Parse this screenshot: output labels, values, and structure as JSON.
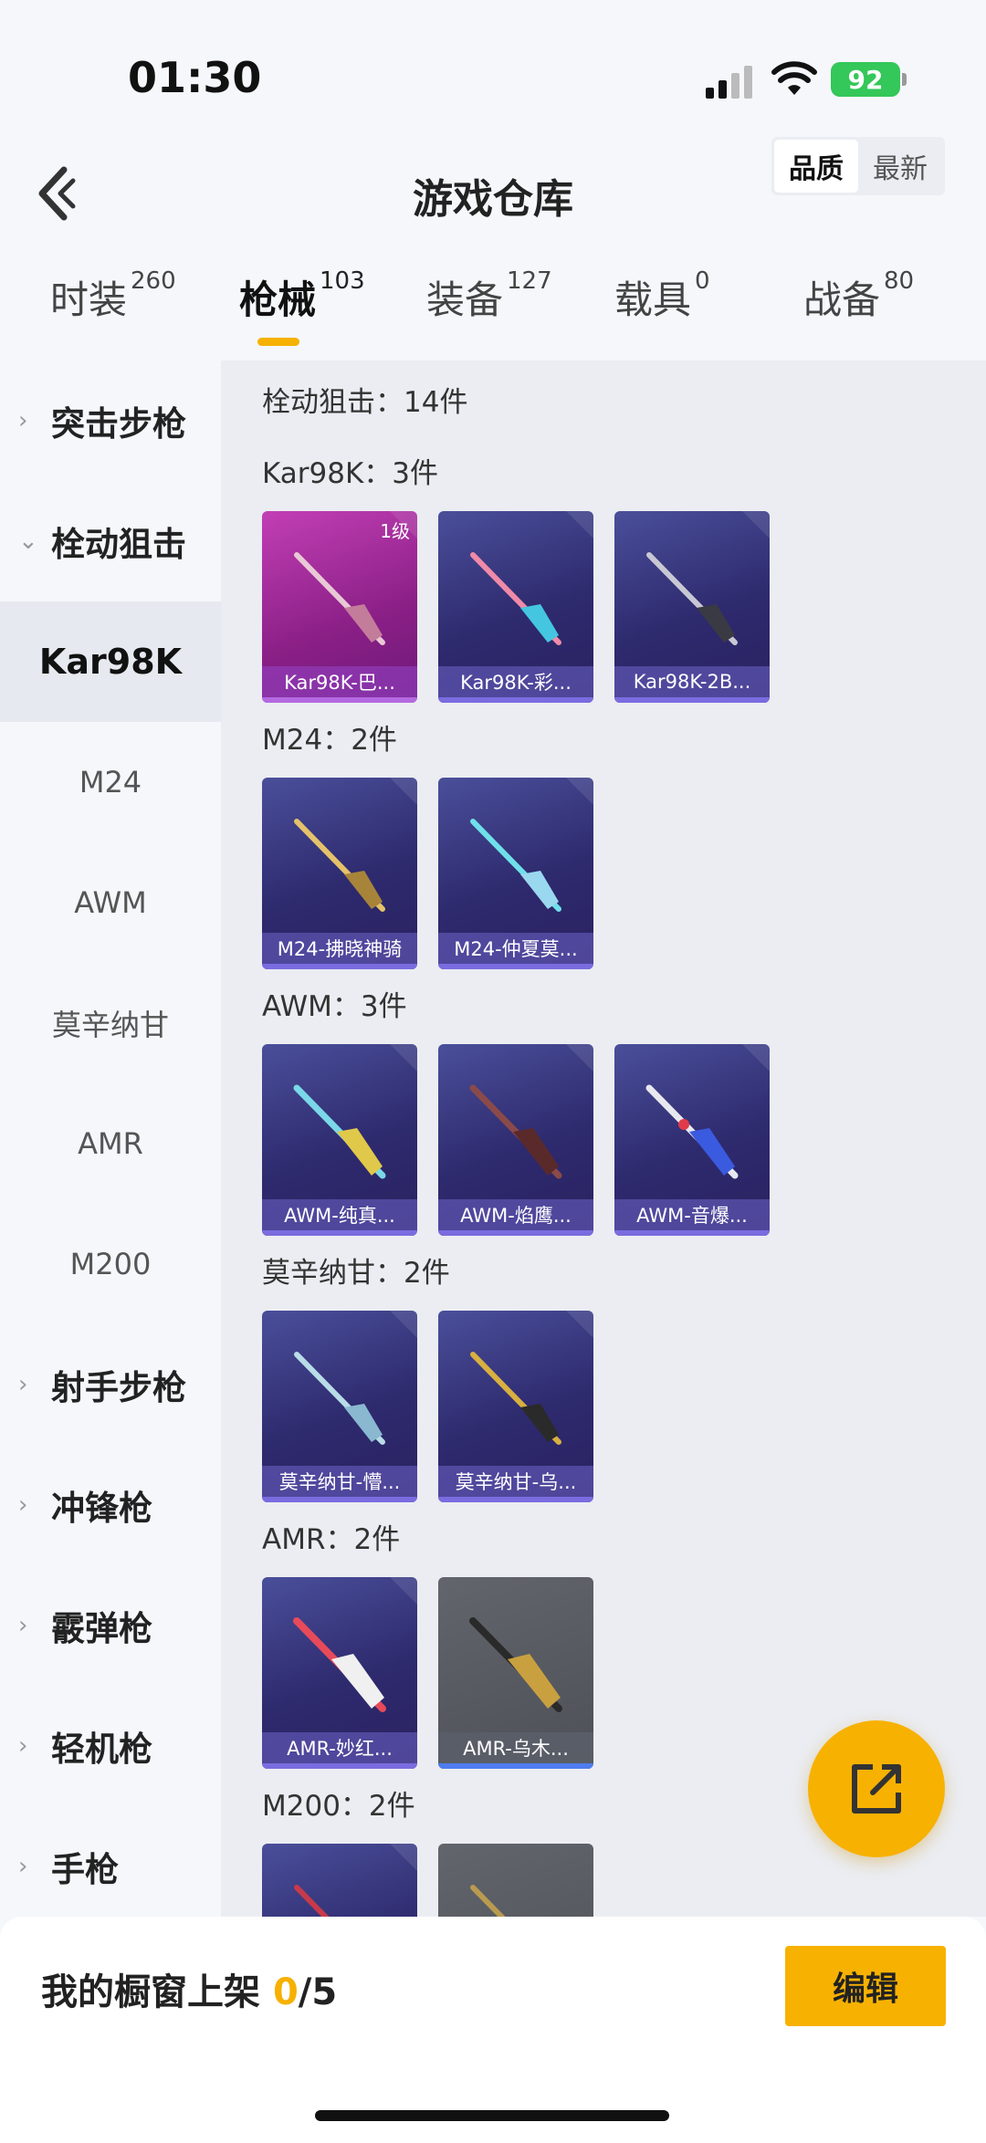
{
  "status": {
    "time": "01:30",
    "battery": "92"
  },
  "header": {
    "title": "游戏仓库",
    "sort_quality": "品质",
    "sort_newest": "最新"
  },
  "tabs": [
    {
      "label": "时装",
      "count": "260"
    },
    {
      "label": "枪械",
      "count": "103"
    },
    {
      "label": "装备",
      "count": "127"
    },
    {
      "label": "载具",
      "count": "0"
    },
    {
      "label": "战备",
      "count": "80"
    }
  ],
  "sidebar": {
    "items": [
      {
        "label": "突击步枪"
      },
      {
        "label": "栓动狙击"
      },
      {
        "label": "Kar98K"
      },
      {
        "label": "M24"
      },
      {
        "label": "AWM"
      },
      {
        "label": "莫辛纳甘"
      },
      {
        "label": "AMR"
      },
      {
        "label": "M200"
      },
      {
        "label": "射手步枪"
      },
      {
        "label": "冲锋枪"
      },
      {
        "label": "霰弹枪"
      },
      {
        "label": "轻机枪"
      },
      {
        "label": "手枪"
      }
    ]
  },
  "content": {
    "category_title": "栓动狙击：14件",
    "sections": [
      {
        "title": "Kar98K：3件",
        "items": [
          {
            "name": "Kar98K-巴...",
            "level": "1级"
          },
          {
            "name": "Kar98K-彩..."
          },
          {
            "name": "Kar98K-2B..."
          }
        ]
      },
      {
        "title": "M24：2件",
        "items": [
          {
            "name": "M24-拂晓神骑"
          },
          {
            "name": "M24-仲夏莫..."
          }
        ]
      },
      {
        "title": "AWM：3件",
        "items": [
          {
            "name": "AWM-纯真..."
          },
          {
            "name": "AWM-焰鹰..."
          },
          {
            "name": "AWM-音爆..."
          }
        ]
      },
      {
        "title": "莫辛纳甘：2件",
        "items": [
          {
            "name": "莫辛纳甘-懵..."
          },
          {
            "name": "莫辛纳甘-乌..."
          }
        ]
      },
      {
        "title": "AMR：2件",
        "items": [
          {
            "name": "AMR-妙红..."
          },
          {
            "name": "AMR-乌木..."
          }
        ]
      },
      {
        "title": "M200：2件"
      }
    ]
  },
  "bottom": {
    "showcase_label": "我的橱窗上架 ",
    "current": "0",
    "total": "/5",
    "edit_label": "编辑"
  },
  "colors": {
    "accent": "#f7b100",
    "card_purple": "#2e2a6e",
    "card_pink": "#8a1f86",
    "card_gray": "#4d5057"
  },
  "icons": [
    "back-icon",
    "signal-icon",
    "wifi-icon",
    "share-icon",
    "chevron-right-icon",
    "chevron-down-icon"
  ]
}
